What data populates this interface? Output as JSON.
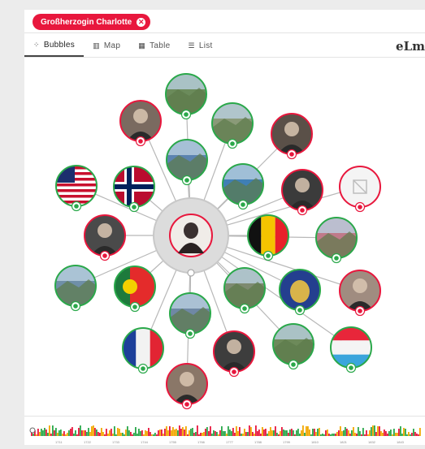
{
  "filter_chip": {
    "label": "Großherzogin Charlotte"
  },
  "tabs": [
    {
      "label": "Bubbles",
      "icon": "bubbles-icon",
      "active": true
    },
    {
      "label": "Map",
      "icon": "map-icon",
      "active": false
    },
    {
      "label": "Table",
      "icon": "table-icon",
      "active": false
    },
    {
      "label": "List",
      "icon": "list-icon",
      "active": false
    }
  ],
  "brand": "eLm",
  "colors": {
    "person": "#e8173d",
    "place": "#2aa84a",
    "accent": "#e8173d"
  },
  "graph": {
    "center": {
      "name": "Großherzogin Charlotte",
      "kind": "person"
    },
    "nodes": [
      {
        "name": "castle-tower",
        "kind": "place"
      },
      {
        "name": "portrait-man-glasses",
        "kind": "person"
      },
      {
        "name": "valley-town",
        "kind": "place"
      },
      {
        "name": "portrait-man-mustache",
        "kind": "person"
      },
      {
        "name": "us-flag",
        "kind": "place"
      },
      {
        "name": "norway-flag",
        "kind": "place"
      },
      {
        "name": "cathedral",
        "kind": "place"
      },
      {
        "name": "church-hill",
        "kind": "place"
      },
      {
        "name": "portrait-general",
        "kind": "person"
      },
      {
        "name": "missing-image",
        "kind": "person"
      },
      {
        "name": "portrait-man-dark-suit",
        "kind": "person"
      },
      {
        "name": "belgium-flag",
        "kind": "place"
      },
      {
        "name": "city-sunset",
        "kind": "place"
      },
      {
        "name": "paris-skyline",
        "kind": "place"
      },
      {
        "name": "portugal-flag",
        "kind": "place"
      },
      {
        "name": "bridge-river",
        "kind": "place"
      },
      {
        "name": "new-york-seal",
        "kind": "place"
      },
      {
        "name": "portrait-woman",
        "kind": "person"
      },
      {
        "name": "london-skyline",
        "kind": "place"
      },
      {
        "name": "france-flag",
        "kind": "place"
      },
      {
        "name": "portrait-uniform",
        "kind": "person"
      },
      {
        "name": "forest-valley",
        "kind": "place"
      },
      {
        "name": "luxembourg-flag",
        "kind": "place"
      },
      {
        "name": "sculpture",
        "kind": "person"
      }
    ]
  },
  "timeline": {
    "ticks": [
      "1711",
      "1722",
      "1733",
      "1744",
      "1755",
      "1766",
      "1777",
      "1788",
      "1799",
      "1810",
      "1821",
      "1832",
      "1843",
      "1854"
    ]
  }
}
